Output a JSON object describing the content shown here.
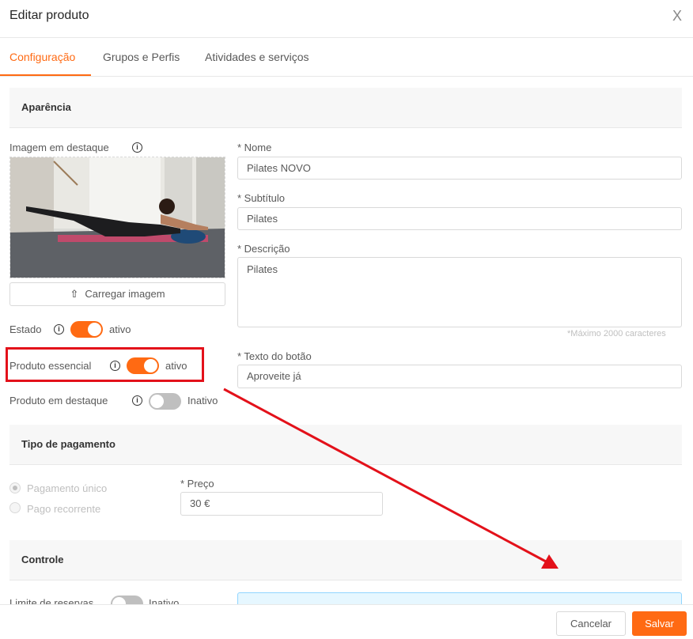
{
  "dialog": {
    "title": "Editar produto",
    "close_glyph": "X"
  },
  "tabs": [
    {
      "label": "Configuração",
      "active": true
    },
    {
      "label": "Grupos e Perfis",
      "active": false
    },
    {
      "label": "Atividades e serviços",
      "active": false
    }
  ],
  "appearance": {
    "section_title": "Aparência",
    "image_label": "Imagem em destaque",
    "image_icon": "pilates-photo",
    "upload_label": "Carregar imagem",
    "estado": {
      "label": "Estado",
      "value": "ativo",
      "on": true
    },
    "essencial": {
      "label": "Produto essencial",
      "value": "ativo",
      "on": true
    },
    "destaque": {
      "label": "Produto em destaque",
      "value": "Inativo",
      "on": false
    },
    "nome": {
      "label": "* Nome",
      "value": "Pilates NOVO"
    },
    "subtitulo": {
      "label": "* Subtítulo",
      "value": "Pilates"
    },
    "descricao": {
      "label": "* Descrição",
      "value": "Pilates",
      "hint": "*Máximo 2000 caracteres"
    },
    "botao": {
      "label": "* Texto do botão",
      "value": "Aproveite já"
    }
  },
  "payment": {
    "section_title": "Tipo de pagamento",
    "options": [
      {
        "label": "Pagamento único",
        "checked": true
      },
      {
        "label": "Pago recorrente",
        "checked": false
      }
    ],
    "price": {
      "label": "* Preço",
      "value": "30 €"
    }
  },
  "control": {
    "section_title": "Controle",
    "limite": {
      "label": "Limite de reservas",
      "value": "Inativo",
      "on": false
    }
  },
  "footer": {
    "cancel_label": "Cancelar",
    "save_label": "Salvar"
  },
  "colors": {
    "accent": "#ff6a13",
    "annotation": "#e3111a",
    "toggle_off": "#bfbfbf"
  }
}
